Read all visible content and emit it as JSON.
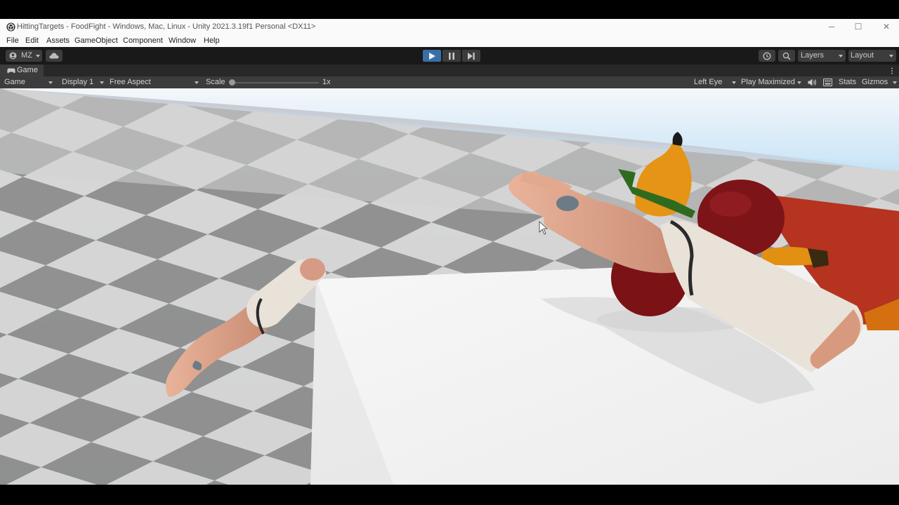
{
  "window": {
    "title": "HittingTargets - FoodFight - Windows, Mac, Linux - Unity 2021.3.19f1 Personal <DX11>",
    "controls": {
      "minimize": "─",
      "maximize": "☐",
      "close": "✕"
    }
  },
  "menu": [
    "File",
    "Edit",
    "Assets",
    "GameObject",
    "Component",
    "Window",
    "Help"
  ],
  "toolbar": {
    "account_label": "MZ",
    "play_state": "playing",
    "layers_label": "Layers",
    "layout_label": "Layout"
  },
  "game_tab": {
    "label": "Game"
  },
  "game_controls": {
    "view_mode": "Game",
    "display": "Display 1",
    "aspect": "Free Aspect",
    "scale_label": "Scale",
    "scale_value": "1x",
    "eye": "Left Eye",
    "play_mode": "Play Maximized",
    "stats_label": "Stats",
    "gizmos_label": "Gizmos"
  },
  "colors": {
    "accent_play": "#3a6ea5",
    "editor_dark": "#191919",
    "panel": "#3c3c3c",
    "sky_top": "#f4f7fb",
    "sky_bottom": "#bfe0f5",
    "floor_dark": "#7a7a7a",
    "floor_light": "#d8d8d8",
    "table": "#f3f3f3"
  }
}
